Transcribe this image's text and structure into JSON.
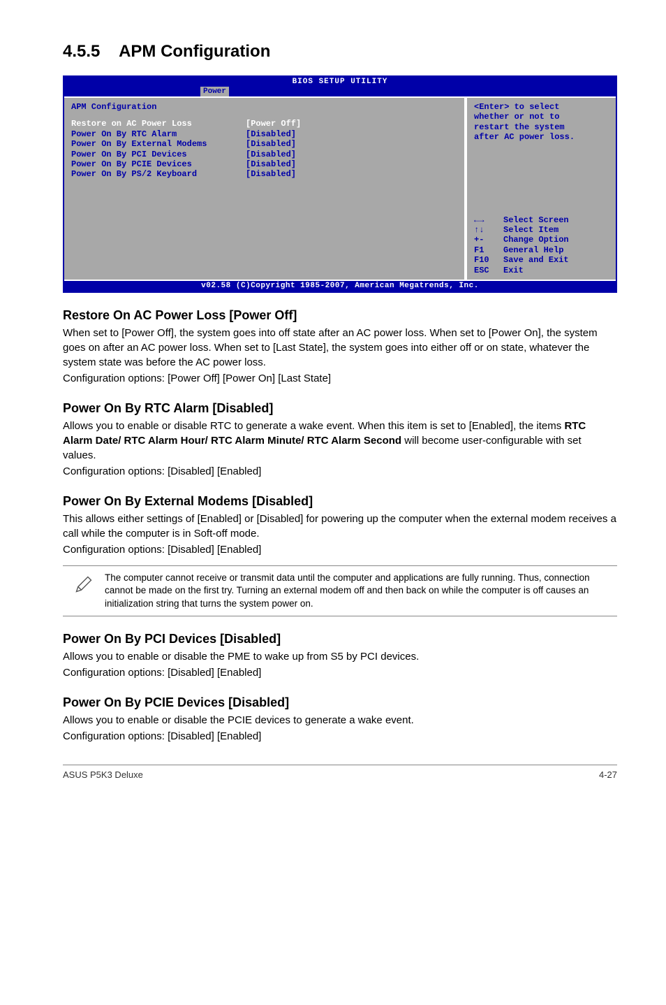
{
  "heading": {
    "number": "4.5.5",
    "title": "APM Configuration"
  },
  "bios": {
    "title": "BIOS SETUP UTILITY",
    "tab": "Power",
    "section_title": "APM Configuration",
    "rows": [
      {
        "key": "Restore on AC Power Loss",
        "val": "[Power Off]",
        "selected": true
      },
      {
        "key": "Power On By RTC Alarm",
        "val": "[Disabled]",
        "selected": false
      },
      {
        "key": "Power On By External Modems",
        "val": "[Disabled]",
        "selected": false
      },
      {
        "key": "Power On By PCI Devices",
        "val": "[Disabled]",
        "selected": false
      },
      {
        "key": "Power On By PCIE Devices",
        "val": "[Disabled]",
        "selected": false
      },
      {
        "key": "Power On By PS/2 Keyboard",
        "val": "[Disabled]",
        "selected": false
      }
    ],
    "help_top": "<Enter> to select\nwhether or not to\nrestart the system\nafter AC power loss.",
    "nav": [
      {
        "key": "←→",
        "label": "Select Screen"
      },
      {
        "key": "↑↓",
        "label": "Select Item"
      },
      {
        "key": "+-",
        "label": "Change Option"
      },
      {
        "key": "F1",
        "label": "General Help"
      },
      {
        "key": "F10",
        "label": "Save and Exit"
      },
      {
        "key": "ESC",
        "label": "Exit"
      }
    ],
    "footer": "v02.58 (C)Copyright 1985-2007, American Megatrends, Inc."
  },
  "sections": [
    {
      "heading": "Restore On AC Power Loss [Power Off]",
      "paragraphs": [
        "When set to [Power Off], the system goes into off state after an AC power loss. When set to [Power On], the system goes on after an AC power loss. When set to [Last State], the system goes into either off or on state, whatever the system state was before the AC power loss.",
        "Configuration options: [Power Off] [Power On] [Last State]"
      ]
    },
    {
      "heading": "Power On By RTC Alarm [Disabled]",
      "paragraphs": [
        "Allows you to enable or disable RTC to generate a wake event. When this item is set to [Enabled], the items <b>RTC Alarm Date/ RTC Alarm Hour/ RTC Alarm Minute/ RTC Alarm Second</b> will become user-configurable with set values.",
        "Configuration options: [Disabled] [Enabled]"
      ]
    },
    {
      "heading": "Power On By External Modems [Disabled]",
      "paragraphs": [
        "This allows either settings of [Enabled] or [Disabled] for powering up the computer when the external modem receives a call while the computer is in Soft-off mode.",
        "Configuration options: [Disabled] [Enabled]"
      ],
      "note": "The computer cannot receive or transmit data until the computer and applications are fully running. Thus, connection cannot be made on the first try. Turning an external modem off and then back on while the computer is off causes an initialization string that turns the system power on."
    },
    {
      "heading": "Power On By PCI Devices [Disabled]",
      "paragraphs": [
        "Allows you to enable or disable the PME to wake up from S5 by PCI devices.",
        "Configuration options: [Disabled] [Enabled]"
      ]
    },
    {
      "heading": "Power On By PCIE Devices [Disabled]",
      "paragraphs": [
        "Allows you to enable or disable the PCIE devices to generate a wake event.",
        "Configuration options: [Disabled] [Enabled]"
      ]
    }
  ],
  "footer": {
    "left": "ASUS P5K3 Deluxe",
    "right": "4-27"
  }
}
